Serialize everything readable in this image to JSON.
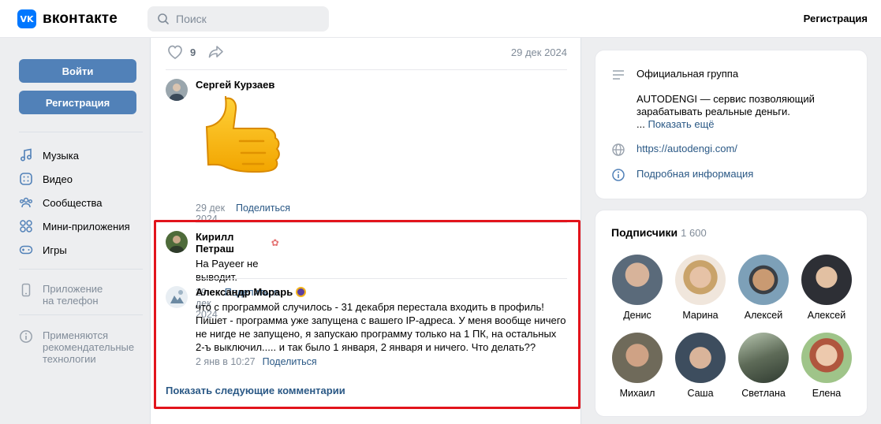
{
  "header": {
    "logo_mark": "VK",
    "logo_text": "вконтакте",
    "search_placeholder": "Поиск",
    "register_link": "Регистрация"
  },
  "sidebar": {
    "login_button": "Войти",
    "register_button": "Регистрация",
    "items": [
      {
        "label": "Музыка",
        "icon": "music-icon"
      },
      {
        "label": "Видео",
        "icon": "video-icon"
      },
      {
        "label": "Сообщества",
        "icon": "communities-icon"
      },
      {
        "label": "Мини-приложения",
        "icon": "apps-icon"
      },
      {
        "label": "Игры",
        "icon": "gamepad-icon"
      }
    ],
    "app_promo": {
      "line1": "Приложение",
      "line2": "на телефон"
    },
    "recommend_note": {
      "line1": "Применяются",
      "line2": "рекомендательные",
      "line3": "технологии"
    }
  },
  "post": {
    "like_count": "9",
    "date": "29 дек 2024"
  },
  "comments": [
    {
      "author": "Сергей Курзаев",
      "sticker": "thumbs-up sticker",
      "date": "29 дек 2024",
      "share": "Поделиться"
    },
    {
      "author": "Кирилл Петраш",
      "text": "На Payeer не выводит.",
      "date": "29 дек 2024",
      "share": "Поделиться"
    },
    {
      "author": "Александр Морарь",
      "text_lines": [
        "что с программой случилось - 31 декабря перестала входить в профиль!",
        "Пишет - программа уже запущена с вашего IP-адреса. У меня вообще ничего",
        "не нигде не запущено, я запускаю программу только на 1 ПК, на остальных",
        "2-ъ выключил..... и так было 1 января, 2 января и ничего. Что делать??"
      ],
      "date": "2 янв в 10:27",
      "share": "Поделиться"
    }
  ],
  "show_more": "Показать следующие комментарии",
  "info_card": {
    "type": "Официальная группа",
    "description_line1": "AUTODENGI — сервис позволяющий",
    "description_line2": "зарабатывать реальные деньги.",
    "ellipsis": "...",
    "show_more": "Показать ещё",
    "website": "https://autodengi.com/",
    "details": "Подробная информация"
  },
  "subscribers": {
    "title": "Подписчики",
    "count": "1 600",
    "people": [
      "Денис",
      "Марина",
      "Алексей",
      "Алексей",
      "Михаил",
      "Саша",
      "Светлана",
      "Елена"
    ]
  },
  "colors": {
    "accent": "#5181b8",
    "link": "#2a5885",
    "highlight": "#e2141c",
    "brand": "#0077ff"
  }
}
